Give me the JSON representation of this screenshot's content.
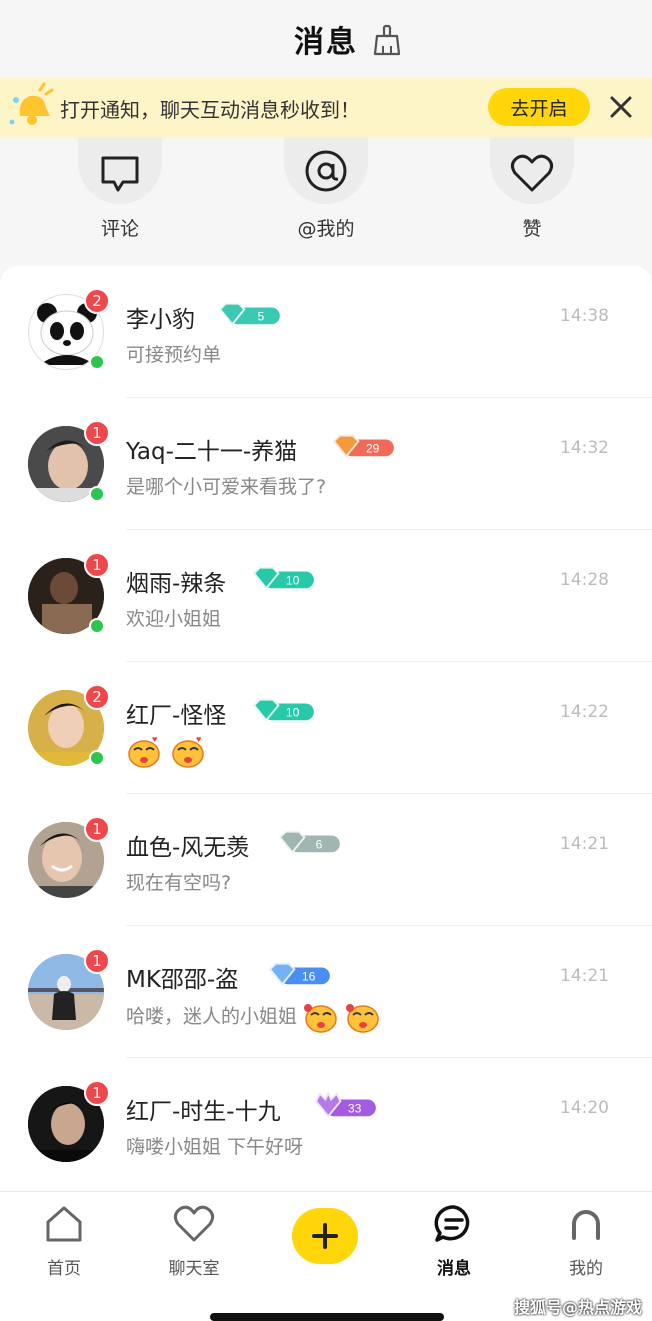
{
  "header": {
    "title": "消息",
    "clear_icon": "broom-icon"
  },
  "notice": {
    "text": "打开通知，聊天互动消息秒收到！",
    "button_label": "去开启",
    "icon": "bell-icon"
  },
  "quick_actions": [
    {
      "label": "评论",
      "icon": "comment-icon"
    },
    {
      "label": "@我的",
      "icon": "at-icon"
    },
    {
      "label": "赞",
      "icon": "heart-icon"
    }
  ],
  "conversations": [
    {
      "name": "李小豹",
      "level": "5",
      "level_color": "#3cc9b4",
      "message": "可接预约单",
      "time": "14:38",
      "unread": "2",
      "online": true,
      "avatar": "panda"
    },
    {
      "name": "Yaq-二十一-养猫",
      "level": "29",
      "level_color": "#f06a57",
      "message": "是哪个小可爱来看我了?",
      "time": "14:32",
      "unread": "1",
      "online": true,
      "avatar": "person"
    },
    {
      "name": "烟雨-辣条",
      "level": "10",
      "level_color": "#27c9a8",
      "message": "欢迎小姐姐",
      "time": "14:28",
      "unread": "1",
      "online": true,
      "avatar": "person"
    },
    {
      "name": "红厂-怪怪",
      "level": "10",
      "level_color": "#27c9a8",
      "message": "",
      "time": "14:22",
      "unread": "2",
      "online": true,
      "avatar": "person",
      "emoji_count": 2
    },
    {
      "name": "血色-风无羡",
      "level": "6",
      "level_color": "#9fb6b2",
      "message": "现在有空吗?",
      "time": "14:21",
      "unread": "1",
      "online": false,
      "avatar": "person"
    },
    {
      "name": "MK邵邵-盗",
      "level": "16",
      "level_color": "#4a8ef0",
      "message": "哈喽，迷人的小姐姐",
      "time": "14:21",
      "unread": "1",
      "online": false,
      "avatar": "person",
      "emoji_count": 2
    },
    {
      "name": "红厂-时生-十九",
      "level": "33",
      "level_color": "#a25ce0",
      "message": "嗨喽小姐姐  下午好呀",
      "time": "14:20",
      "unread": "1",
      "online": false,
      "avatar": "person"
    }
  ],
  "tabbar": [
    {
      "label": "首页",
      "icon": "home-icon"
    },
    {
      "label": "聊天室",
      "icon": "heart-outline-icon"
    },
    {
      "label": "",
      "icon": "plus-icon"
    },
    {
      "label": "消息",
      "icon": "message-icon",
      "active": true
    },
    {
      "label": "我的",
      "icon": "profile-icon"
    }
  ],
  "watermark": "搜狐号@热点游戏"
}
